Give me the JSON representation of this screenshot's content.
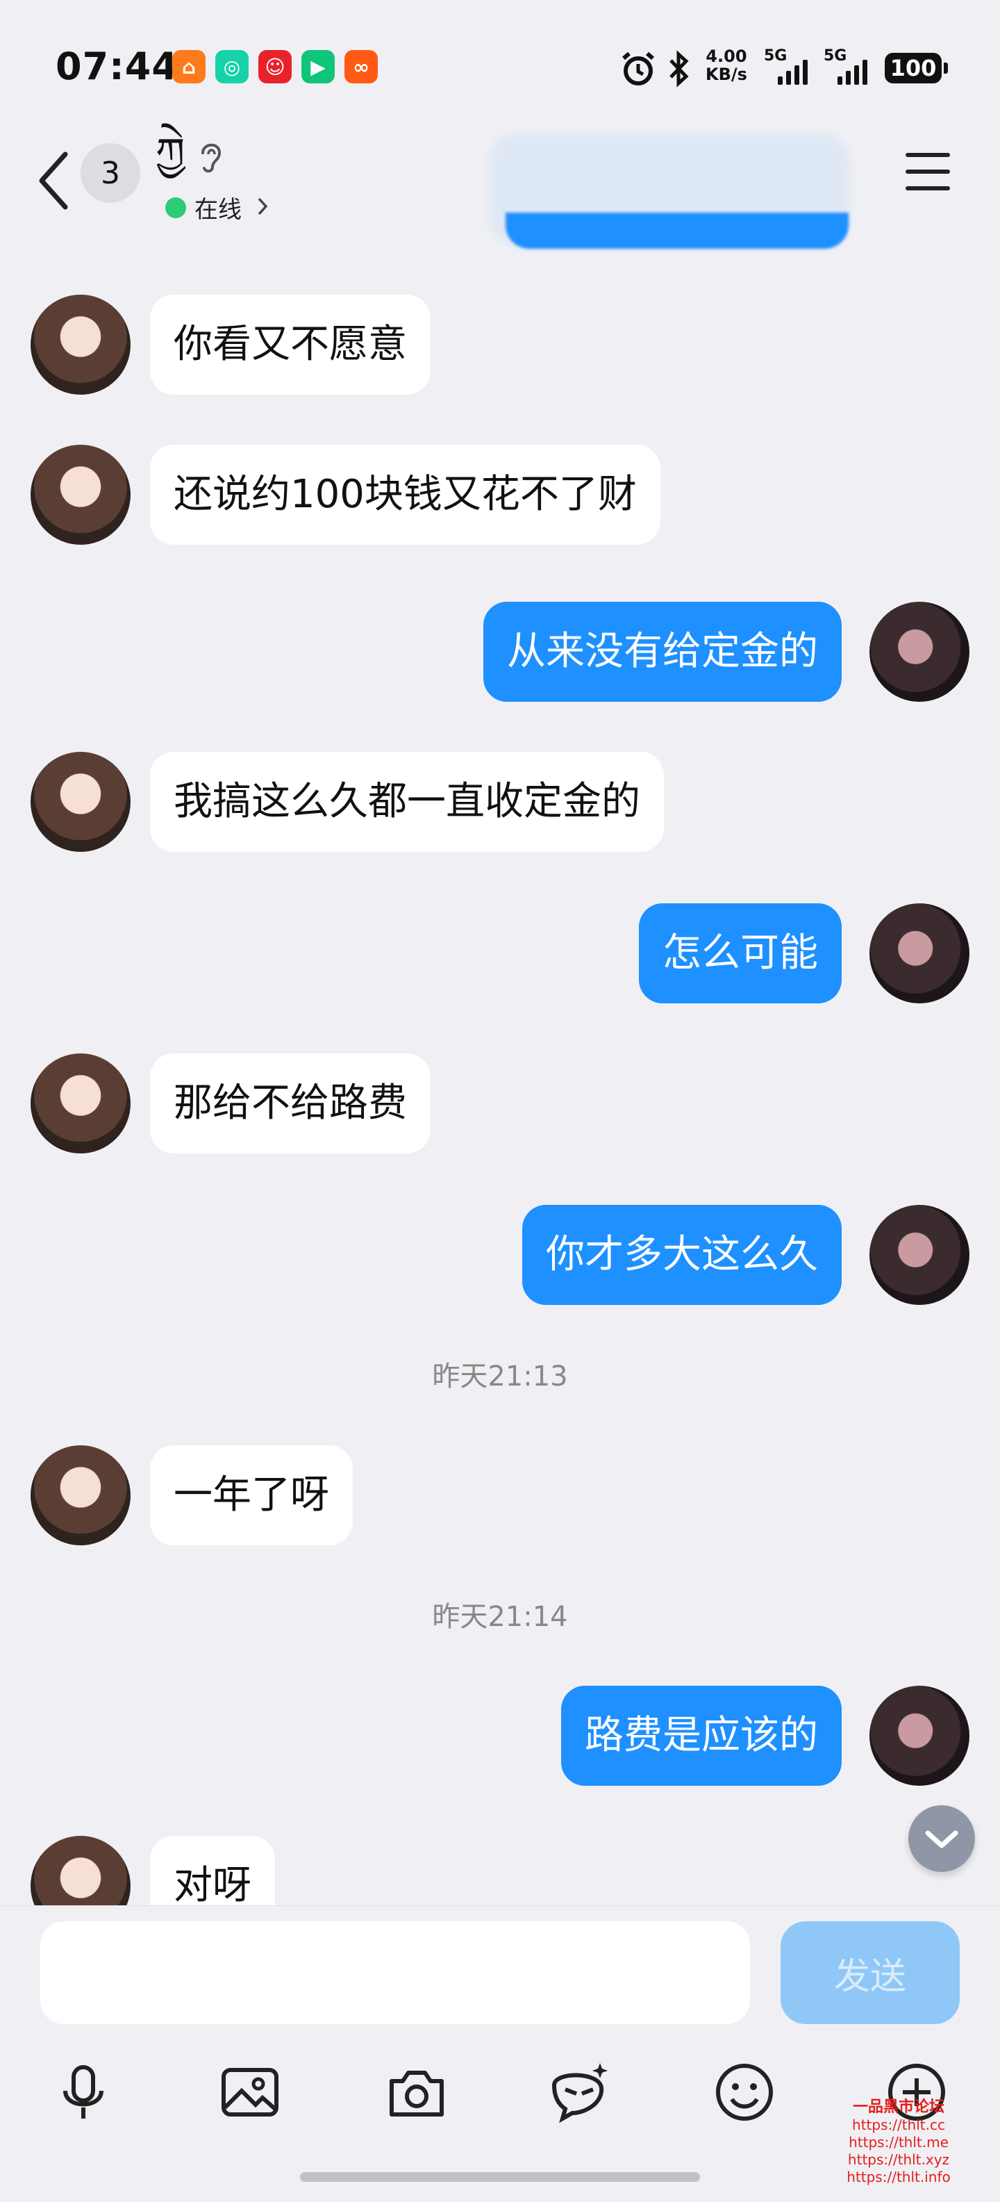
{
  "status_bar": {
    "time": "07:44",
    "net_speed_value": "4.00",
    "net_speed_unit": "KB/s",
    "sim1_label": "5G",
    "sim2_label": "5G",
    "battery": "100",
    "app_icons": [
      "taobao-icon",
      "camera-app-icon",
      "pinduoduo-icon",
      "video-app-icon",
      "kuaishou-icon"
    ]
  },
  "header": {
    "unread_count": "3",
    "contact_name": "ཀྱེ",
    "online_status": "在线"
  },
  "messages": [
    {
      "side": "in",
      "text": "你看又不愿意"
    },
    {
      "side": "in",
      "text": "还说约100块钱又花不了财"
    },
    {
      "side": "out",
      "text": "从来没有给定金的"
    },
    {
      "side": "in",
      "text": "我搞这么久都一直收定金的"
    },
    {
      "side": "out",
      "text": "怎么可能"
    },
    {
      "side": "in",
      "text": "那给不给路费"
    },
    {
      "side": "out",
      "text": "你才多大这么久"
    },
    {
      "type": "time",
      "text": "昨天21:13"
    },
    {
      "side": "in",
      "text": "一年了呀"
    },
    {
      "type": "time",
      "text": "昨天21:14"
    },
    {
      "side": "out",
      "text": "路费是应该的"
    },
    {
      "side": "in",
      "text": "对呀"
    }
  ],
  "composer": {
    "input_value": "",
    "send_label": "发送",
    "tools": [
      "microphone-icon",
      "image-icon",
      "camera-icon",
      "ai-assistant-icon",
      "emoji-icon",
      "plus-icon"
    ]
  },
  "watermark": {
    "title": "一品黑市论坛",
    "urls": [
      "https://thlt.cc",
      "https://thlt.me",
      "https://thlt.xyz",
      "https://thlt.info"
    ]
  },
  "colors": {
    "outgoing_bubble": "#1e90ff",
    "incoming_bubble": "#ffffff",
    "background": "#f0f0f4",
    "online_dot": "#2ecc71",
    "send_button": "#8fc8f6"
  }
}
